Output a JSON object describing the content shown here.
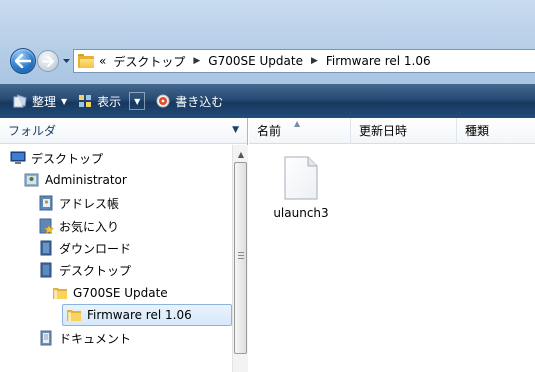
{
  "address_bar": {
    "overflow": "«",
    "crumbs": [
      "デスクトップ",
      "G700SE Update",
      "Firmware rel 1.06"
    ]
  },
  "command_bar": {
    "organize": "整理",
    "views": "表示",
    "burn": "書き込む"
  },
  "left_pane": {
    "header": "フォルダ",
    "tree": [
      {
        "label": "デスクトップ",
        "icon": "desktop-icon"
      },
      {
        "label": "Administrator",
        "icon": "user-folder-icon"
      },
      {
        "label": "アドレス帳",
        "icon": "contacts-icon"
      },
      {
        "label": "お気に入り",
        "icon": "favorites-icon"
      },
      {
        "label": "ダウンロード",
        "icon": "downloads-icon"
      },
      {
        "label": "デスクトップ",
        "icon": "desktop-folder-icon"
      },
      {
        "label": "G700SE Update",
        "icon": "folder-icon"
      },
      {
        "label": "Firmware rel 1.06",
        "icon": "folder-icon"
      },
      {
        "label": "ドキュメント",
        "icon": "documents-icon"
      }
    ],
    "selected_index": 7
  },
  "right_pane": {
    "columns": [
      "名前",
      "更新日時",
      "種類"
    ],
    "files": [
      {
        "name": "ulaunch3",
        "icon": "blank-file-icon"
      }
    ]
  },
  "colors": {
    "command_bar": "#274a74",
    "selection": "#d6e8fb",
    "folder": "#f2c440"
  }
}
